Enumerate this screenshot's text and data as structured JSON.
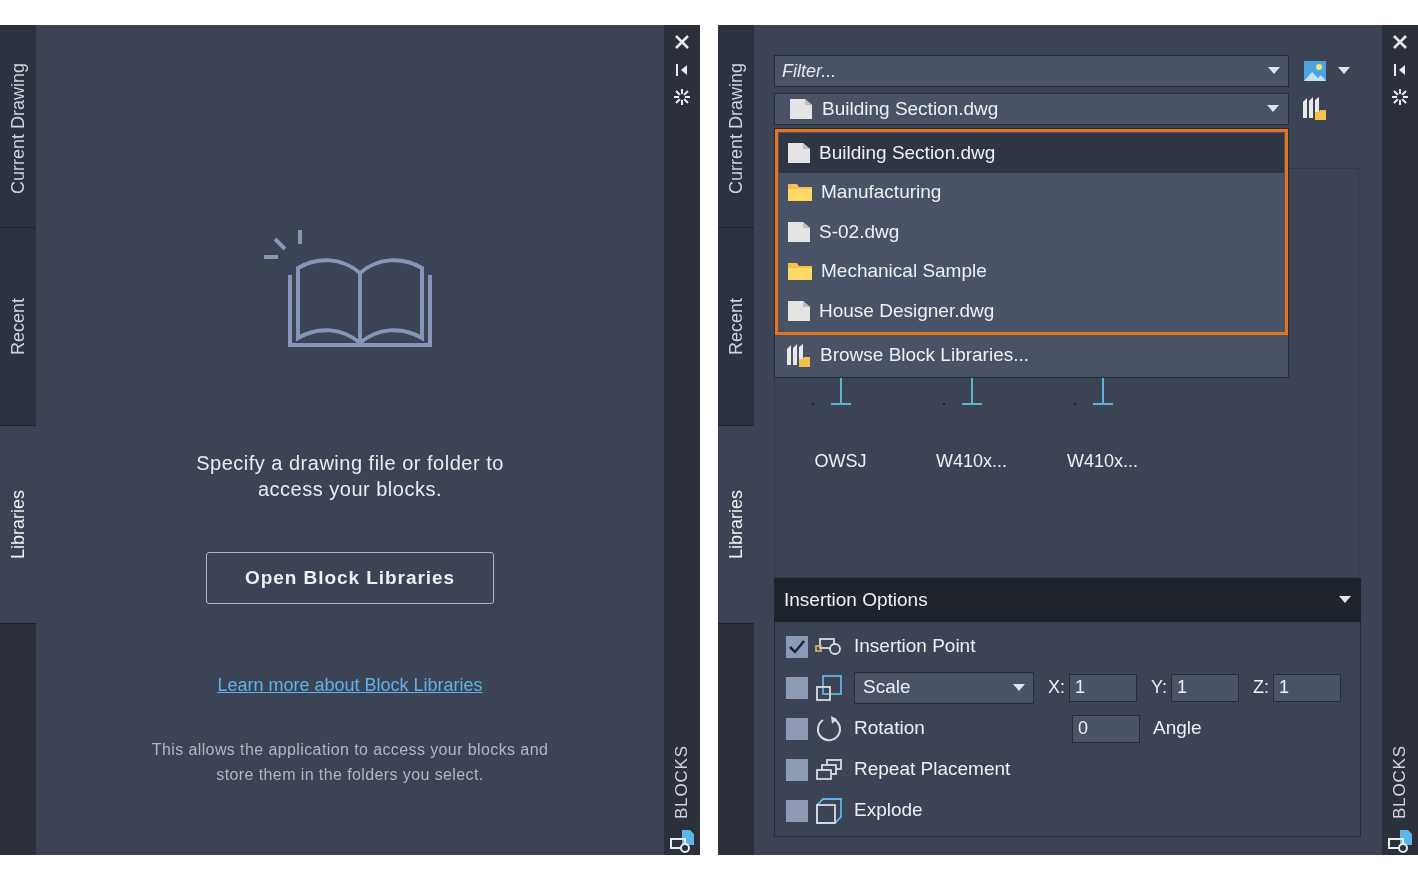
{
  "panels": [
    {
      "kind": "empty",
      "palette_title": "BLOCKS",
      "tabs": [
        {
          "label": "Current Drawing",
          "selected": false
        },
        {
          "label": "Recent",
          "selected": false
        },
        {
          "label": "Libraries",
          "selected": true
        }
      ],
      "message": "Specify a drawing file or folder to access your blocks.",
      "button": "Open Block Libraries",
      "link": "Learn more about Block Libraries",
      "note": "This allows the application to access your blocks and store them in the folders you select."
    },
    {
      "kind": "library",
      "palette_title": "BLOCKS",
      "tabs": [
        {
          "label": "Current Drawing",
          "selected": false
        },
        {
          "label": "Recent",
          "selected": false
        },
        {
          "label": "Libraries",
          "selected": true
        }
      ],
      "filter": {
        "placeholder": "Filter..."
      },
      "library_select": {
        "value": "Building Section.dwg"
      },
      "dropdown": {
        "items": [
          {
            "label": "Building Section.dwg",
            "kind": "file",
            "selected": true
          },
          {
            "label": "Manufacturing",
            "kind": "folder",
            "selected": false
          },
          {
            "label": "S-02.dwg",
            "kind": "file",
            "selected": false
          },
          {
            "label": "Mechanical Sample",
            "kind": "folder",
            "selected": false
          },
          {
            "label": "House Designer.dwg",
            "kind": "file",
            "selected": false
          }
        ],
        "browse": "Browse Block Libraries..."
      },
      "blocks": [
        {
          "name": "OWSJ"
        },
        {
          "name": "W410x..."
        },
        {
          "name": "W410x..."
        }
      ],
      "insertion_options": {
        "title": "Insertion Options",
        "expanded": true,
        "rows": [
          {
            "kind": "insertion-point",
            "label": "Insertion Point",
            "checked": true
          },
          {
            "kind": "scale",
            "checked": false,
            "select": "Scale",
            "fields": [
              {
                "label": "X:",
                "value": "1"
              },
              {
                "label": "Y:",
                "value": "1"
              },
              {
                "label": "Z:",
                "value": "1"
              }
            ]
          },
          {
            "kind": "rotation",
            "label": "Rotation",
            "checked": false,
            "value": "0",
            "unit": "Angle"
          },
          {
            "kind": "repeat",
            "label": "Repeat Placement",
            "checked": false
          },
          {
            "kind": "explode",
            "label": "Explode",
            "checked": false
          }
        ]
      }
    }
  ]
}
